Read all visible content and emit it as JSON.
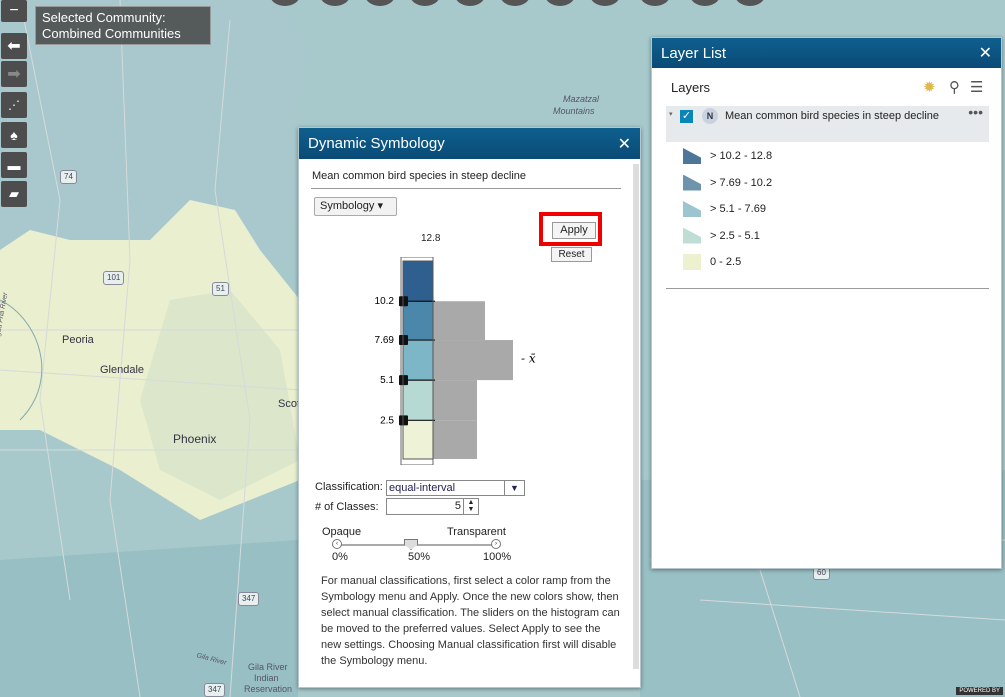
{
  "community": {
    "line1": "Selected Community:",
    "line2": "Combined Communities"
  },
  "map_labels": {
    "peoria": "Peoria",
    "glendale": "Glendale",
    "phoenix": "Phoenix",
    "scottsdale": "Scot",
    "mazatzal": "Mazatzal",
    "mountains": "Mountains",
    "agua_fria": "Agua Fria River",
    "gila_bend": "Gila River",
    "gila_river_1": "Gila River",
    "gila_river_2": "Indian",
    "gila_river_3": "Reservation",
    "hwy_74": "74",
    "hwy_101": "101",
    "hwy_51": "51",
    "hwy_347a": "347",
    "hwy_347b": "347",
    "hwy_60": "60"
  },
  "dynamic_symbology": {
    "title": "Dynamic Symbology",
    "close": "✕",
    "layer_name": "Mean common bird species in steep decline",
    "symbology_button": "Symbology ▾",
    "apply": "Apply",
    "reset": "Reset",
    "max": "12.8",
    "min": "0",
    "breaks": [
      "10.2",
      "7.69",
      "5.1",
      "2.5"
    ],
    "mean_symbol": "x̄",
    "classification_label": "Classification:",
    "classification_value": "equal-interval",
    "classes_label": "# of Classes:",
    "classes_value": "5",
    "opaque": "Opaque",
    "transparent": "Transparent",
    "pct_0": "0%",
    "pct_50": "50%",
    "pct_100": "100%",
    "opacity_level": 0.5,
    "instructions": "For manual classifications, first select a color ramp from the Symbology menu and Apply. Once the new colors show, then select manual classification. The sliders on the histogram can be moved to the preferred values. Select Apply to see the new settings. Choosing Manual classification first will disable the Symbology menu.",
    "ramp_colors": [
      "#2f5f8f",
      "#4b86ab",
      "#7db6c6",
      "#b6d9d4",
      "#eef3d8"
    ],
    "histogram": [
      {
        "from": 10.2,
        "to": 12.8,
        "count": 0.0
      },
      {
        "from": 7.69,
        "to": 10.2,
        "count": 0.65
      },
      {
        "from": 5.1,
        "to": 7.69,
        "count": 1.0
      },
      {
        "from": 2.5,
        "to": 5.1,
        "count": 0.55
      },
      {
        "from": 0,
        "to": 2.5,
        "count": 0.55
      }
    ]
  },
  "layer_list": {
    "title": "Layer List",
    "close": "✕",
    "heading": "Layers",
    "badge": "N",
    "layer_name": "Mean common bird species in steep decline",
    "more": "•••",
    "legend": [
      {
        "label": "> 10.2 - 12.8",
        "color": "#4d7699"
      },
      {
        "label": "> 7.69 - 10.2",
        "color": "#6d93ad"
      },
      {
        "label": "> 5.1 - 7.69",
        "color": "#9cc5cf"
      },
      {
        "label": "> 2.5 - 5.1",
        "color": "#bfddd4"
      },
      {
        "label": "0 - 2.5",
        "color": "#eef1d0"
      }
    ]
  },
  "powered_by": "POWERED BY"
}
